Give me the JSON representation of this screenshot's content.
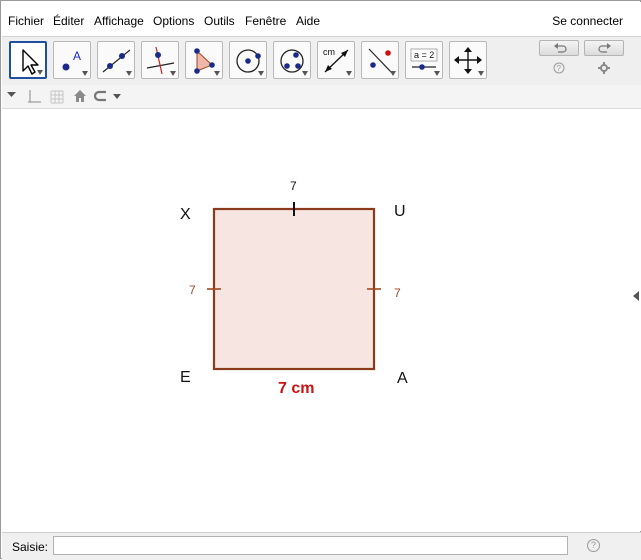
{
  "menu": {
    "items": [
      "Fichier",
      "Éditer",
      "Affichage",
      "Options",
      "Outils",
      "Fenêtre",
      "Aide"
    ],
    "signin": "Se connecter"
  },
  "toolbar": {
    "tools": [
      "move-tool",
      "point-tool",
      "line-tool",
      "perpendicular-line-tool",
      "polygon-tool",
      "circle-tool",
      "conic-tool",
      "distance-tool",
      "reflect-tool",
      "slider-tool",
      "move-view-tool"
    ],
    "selected": "move-tool",
    "slider_text": "a = 2",
    "distance_text": "cm"
  },
  "graphics": {
    "vertices": {
      "top_left": "X",
      "top_right": "U",
      "bottom_left": "E",
      "bottom_right": "A"
    },
    "side_lengths": {
      "top": "7",
      "left": "7",
      "right": "7"
    },
    "bottom_measure": "7 cm",
    "colors": {
      "square_stroke": "#8b3a1a",
      "square_fill": "#f6e5e0",
      "measure_text": "#cc1111",
      "side_text": "#a0481f"
    }
  },
  "inputbar": {
    "label": "Saisie:",
    "value": "",
    "help": "?"
  }
}
